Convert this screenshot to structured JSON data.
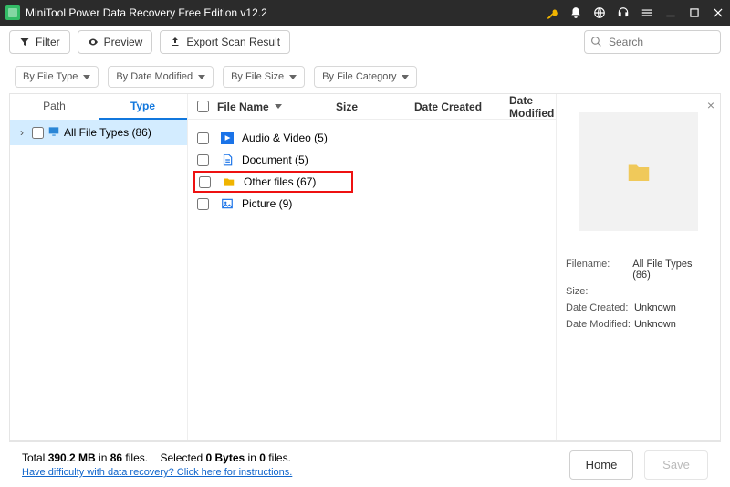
{
  "titlebar": {
    "title": "MiniTool Power Data Recovery Free Edition v12.2"
  },
  "toolbar": {
    "filter": "Filter",
    "preview": "Preview",
    "export": "Export Scan Result",
    "search_placeholder": "Search"
  },
  "filters": {
    "by_type": "By File Type",
    "by_date": "By Date Modified",
    "by_size": "By File Size",
    "by_category": "By File Category"
  },
  "sidebar": {
    "tab_path": "Path",
    "tab_type": "Type",
    "tree_root": "All File Types (86)"
  },
  "columns": {
    "name": "File Name",
    "size": "Size",
    "date_created": "Date Created",
    "date_modified": "Date Modified"
  },
  "files": {
    "av": "Audio & Video (5)",
    "doc": "Document (5)",
    "other": "Other files (67)",
    "pic": "Picture (9)"
  },
  "preview": {
    "filename_k": "Filename:",
    "filename_v": "All File Types (86)",
    "size_k": "Size:",
    "size_v": "",
    "dc_k": "Date Created:",
    "dc_v": "Unknown",
    "dm_k": "Date Modified:",
    "dm_v": "Unknown"
  },
  "footer": {
    "totals_prefix": "Total ",
    "totals_mb": "390.2 MB",
    "totals_in": " in ",
    "totals_files": "86",
    "totals_files_suffix": " files.",
    "selected_prefix": "Selected ",
    "selected_bytes": "0 Bytes",
    "selected_in": " in ",
    "selected_files": "0",
    "selected_files_suffix": " files.",
    "help": "Have difficulty with data recovery? Click here for instructions.",
    "home": "Home",
    "save": "Save"
  }
}
